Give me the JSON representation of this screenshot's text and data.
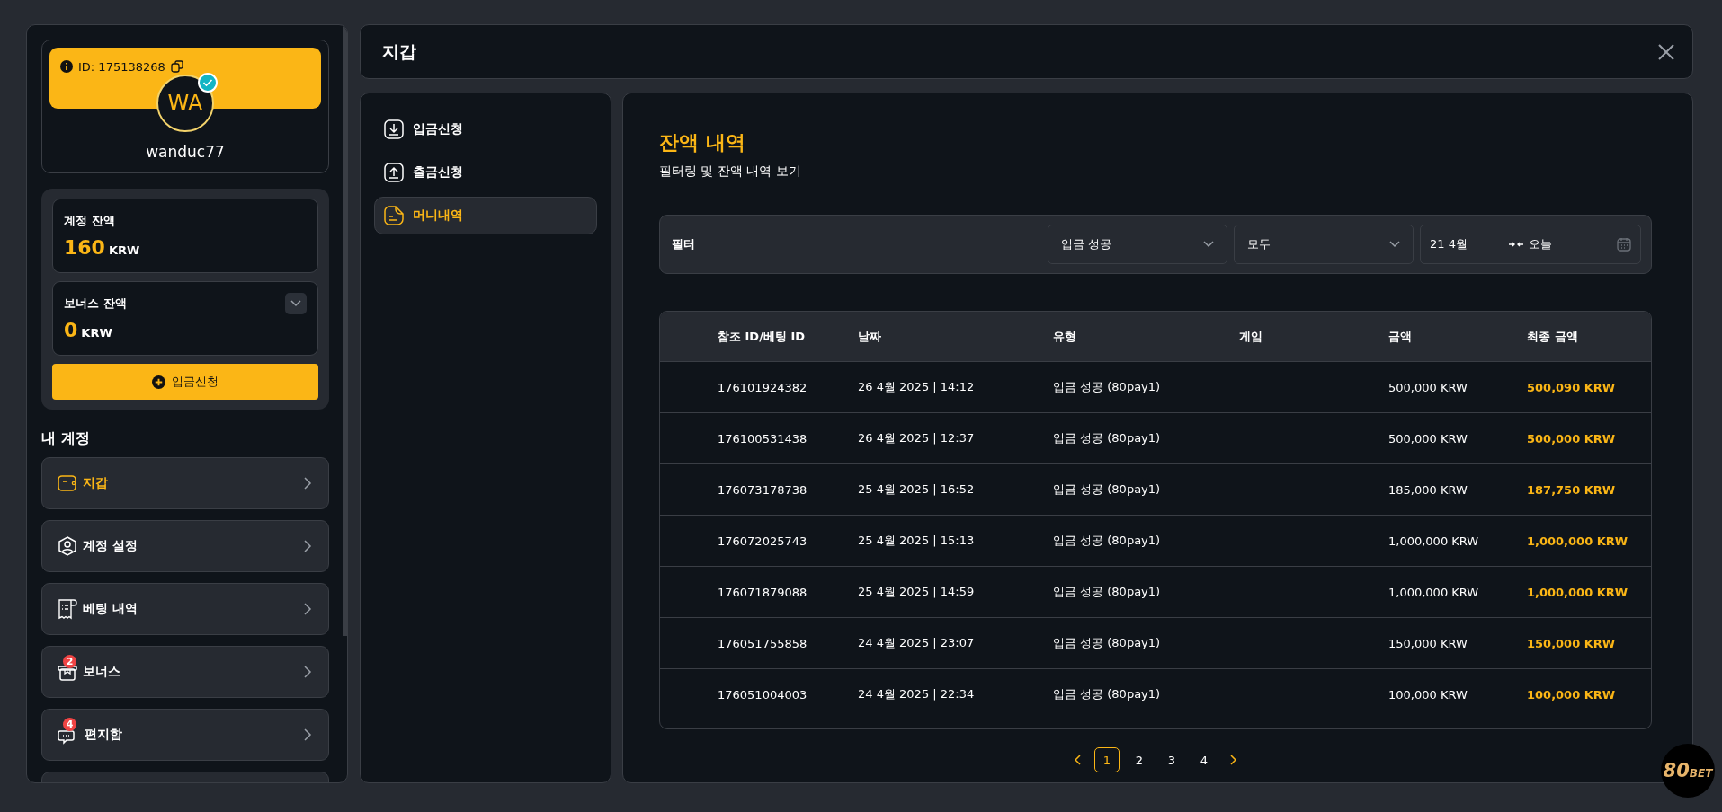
{
  "profile": {
    "id_label": "ID: 175138268",
    "initials": "WA",
    "verified": true,
    "username": "wanduc77"
  },
  "balances": [
    {
      "label": "계정 잔액",
      "amount": "160",
      "currency": "KRW",
      "expandable": false
    },
    {
      "label": "보너스 잔액",
      "amount": "0",
      "currency": "KRW",
      "expandable": true
    }
  ],
  "deposit_button": "입금신청",
  "account_menu": {
    "title": "내 계정",
    "items": [
      {
        "label": "지갑",
        "selected": true
      },
      {
        "label": "계정 설정",
        "selected": false
      },
      {
        "label": "베팅 내역",
        "selected": false
      },
      {
        "label": "보너스",
        "badge": "2",
        "selected": false
      },
      {
        "label": "편지함",
        "badge": "4",
        "selected": false
      }
    ]
  },
  "window": {
    "title": "지갑"
  },
  "wallet_nav": [
    {
      "label": "입금신청",
      "selected": false
    },
    {
      "label": "출금신청",
      "selected": false
    },
    {
      "label": "머니내역",
      "selected": true
    }
  ],
  "history": {
    "title": "잔액 내역",
    "subtitle": "필터링 및 잔액 내역 보기",
    "filter": {
      "label": "필터",
      "status": "입금 성공",
      "category": "모두",
      "date_from": "21 4월",
      "date_to": "오늘"
    },
    "table": {
      "columns": [
        "참조 ID/베팅 ID",
        "날짜",
        "유형",
        "게임",
        "금액",
        "최종 금액"
      ],
      "rows": [
        [
          "176101924382",
          "26 4월 2025 | 14:12",
          "입금 성공 (80pay1)",
          "",
          "500,000 KRW",
          "500,090 KRW"
        ],
        [
          "176100531438",
          "26 4월 2025 | 12:37",
          "입금 성공 (80pay1)",
          "",
          "500,000 KRW",
          "500,000 KRW"
        ],
        [
          "176073178738",
          "25 4월 2025 | 16:52",
          "입금 성공 (80pay1)",
          "",
          "185,000 KRW",
          "187,750 KRW"
        ],
        [
          "176072025743",
          "25 4월 2025 | 15:13",
          "입금 성공 (80pay1)",
          "",
          "1,000,000 KRW",
          "1,000,000 KRW"
        ],
        [
          "176071879088",
          "25 4월 2025 | 14:59",
          "입금 성공 (80pay1)",
          "",
          "1,000,000 KRW",
          "1,000,000 KRW"
        ],
        [
          "176051755858",
          "24 4월 2025 | 23:07",
          "입금 성공 (80pay1)",
          "",
          "150,000 KRW",
          "150,000 KRW"
        ],
        [
          "176051004003",
          "24 4월 2025 | 22:34",
          "입금 성공 (80pay1)",
          "",
          "100,000 KRW",
          "100,000 KRW"
        ]
      ]
    },
    "pagination": {
      "pages": [
        {
          "label": "1",
          "selected": true
        },
        {
          "label": "2",
          "selected": false
        },
        {
          "label": "3",
          "selected": false
        },
        {
          "label": "4",
          "selected": false
        }
      ]
    }
  },
  "logo": {
    "number": "80",
    "word": "BET"
  }
}
